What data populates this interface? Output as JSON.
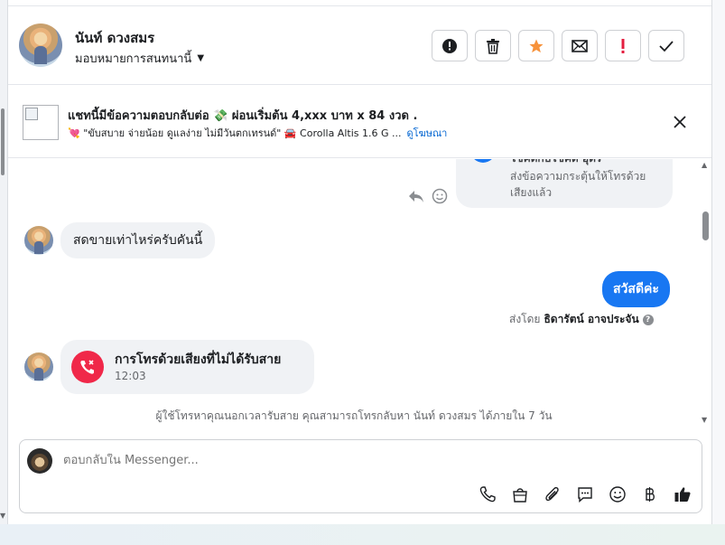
{
  "header": {
    "contact_name": "นันท์ ดวงสมร",
    "assign_label": "มอบหมายการสนทนานี้",
    "actions": [
      {
        "name": "report-button",
        "icon": "alert-circle-icon"
      },
      {
        "name": "delete-button",
        "icon": "trash-icon"
      },
      {
        "name": "star-button",
        "icon": "star-icon",
        "color": "#f7923b"
      },
      {
        "name": "mail-button",
        "icon": "envelope-icon"
      },
      {
        "name": "priority-button",
        "icon": "exclamation-icon",
        "color": "#e41e3f"
      },
      {
        "name": "done-button",
        "icon": "check-icon"
      }
    ]
  },
  "ad": {
    "title": "แชทนี้มีข้อความตอบกลับต่อ 💸 ผ่อนเริ่มต้น 4,xxx บาท x 84 งวด .",
    "subtitle": "💘 \"ขับสบาย จ่ายน้อย ดูแลง่าย ไม่มีวันตกเทรนด์\" 🚘 Corolla Altis 1.6 G ...",
    "link": "ดูโฆษณา"
  },
  "messages": {
    "previous_title": "โชคดีกับโชคดี อุ๊ตร",
    "previous_text": "ส่งข้อความกระตุ้นให้โทรด้วยเสียงแล้ว",
    "incoming_1": "สดขายเท่าไหร่ครับคันนี้",
    "outgoing_1": "สวัสดีค่ะ",
    "sent_by_prefix": "ส่งโดย",
    "sent_by_name": "ธิดารัตน์ อาจประจัน",
    "missed_call_title": "การโทรด้วยเสียงที่ไม่ได้รับสาย",
    "missed_call_time": "12:03",
    "notice": "ผู้ใช้โทรหาคุณนอกเวลารับสาย คุณสามารถโทรกลับหา นันท์ ดวงสมร ได้ภายใน 7 วัน"
  },
  "composer": {
    "placeholder": "ตอบกลับใน Messenger...",
    "tools": [
      "phone-icon",
      "shopping-bag-icon",
      "paperclip-icon",
      "chat-bubble-icon",
      "emoji-icon",
      "baht-icon",
      "thumbs-up-icon"
    ]
  },
  "colors": {
    "accent": "#1877f2",
    "missed_call": "#f02849",
    "star": "#f7923b",
    "priority": "#e41e3f"
  }
}
